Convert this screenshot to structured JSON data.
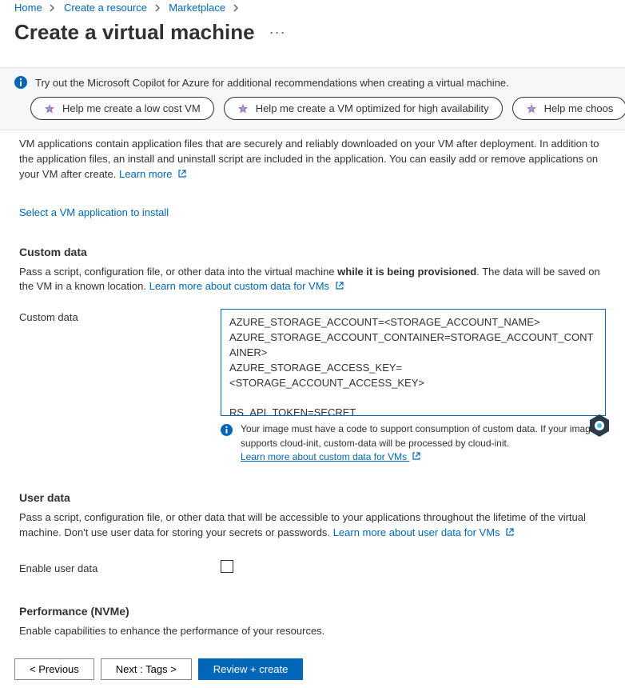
{
  "breadcrumb": {
    "items": [
      "Home",
      "Create a resource",
      "Marketplace"
    ]
  },
  "page": {
    "title": "Create a virtual machine"
  },
  "copilot_banner": {
    "text": "Try out the Microsoft Copilot for Azure for additional recommendations when creating a virtual machine.",
    "pills": [
      "Help me create a low cost VM",
      "Help me create a VM optimized for high availability",
      "Help me choos"
    ]
  },
  "vm_apps": {
    "partial_paragraph": "VM applications contain application files that are securely and reliably downloaded on your VM after deployment. In addition to the application files, an install and uninstall script are included in the application. You can easily add or remove applications on your VM after create.",
    "learn_more": "Learn more",
    "select_link": "Select a VM application to install"
  },
  "custom_data": {
    "heading": "Custom data",
    "para_pre": "Pass a script, configuration file, or other data into the virtual machine ",
    "para_bold": "while it is being provisioned",
    "para_post": ". The data will be saved on the VM in a known location.",
    "learn_more": "Learn more about custom data for VMs",
    "field_label": "Custom data",
    "value": "AZURE_STORAGE_ACCOUNT=<STORAGE_ACCOUNT_NAME>\nAZURE_STORAGE_ACCOUNT_CONTAINER=STORAGE_ACCOUNT_CONTAINER>\nAZURE_STORAGE_ACCESS_KEY=<STORAGE_ACCOUNT_ACCESS_KEY>\n\nRS_API_TOKEN=SECRET",
    "note": "Your image must have a code to support consumption of custom data. If your image supports cloud-init, custom-data will be processed by cloud-init.",
    "note_link": "Learn more about custom data for VMs"
  },
  "user_data": {
    "heading": "User data",
    "para": "Pass a script, configuration file, or other data that will be accessible to your applications throughout the lifetime of the virtual machine. Don't use user data for storing your secrets or passwords.",
    "learn_more": "Learn more about user data for VMs",
    "enable_label": "Enable user data"
  },
  "perf": {
    "heading": "Performance (NVMe)",
    "para": "Enable capabilities to enhance the performance of your resources."
  },
  "footer": {
    "previous": "< Previous",
    "next": "Next : Tags >",
    "review": "Review + create"
  }
}
